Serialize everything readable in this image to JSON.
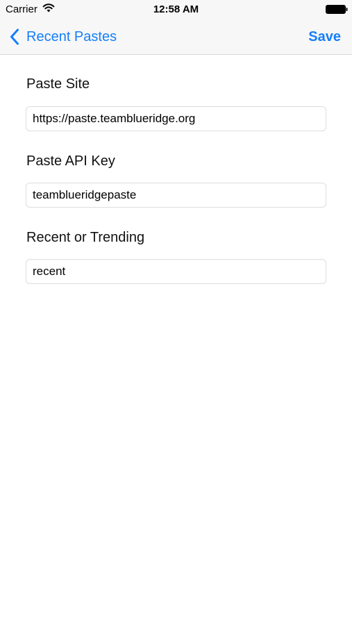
{
  "status_bar": {
    "carrier": "Carrier",
    "time": "12:58 AM",
    "wifi_icon": "wifi-icon",
    "battery_icon": "battery-icon"
  },
  "nav": {
    "back_icon": "chevron-left-icon",
    "back_label": "Recent Pastes",
    "save_label": "Save",
    "accent_color": "#157efb"
  },
  "form": {
    "paste_site": {
      "label": "Paste Site",
      "value": "https://paste.teamblueridge.org"
    },
    "api_key": {
      "label": "Paste API Key",
      "value": "teamblueridgepaste"
    },
    "mode": {
      "label": "Recent or Trending",
      "value": "recent"
    }
  }
}
